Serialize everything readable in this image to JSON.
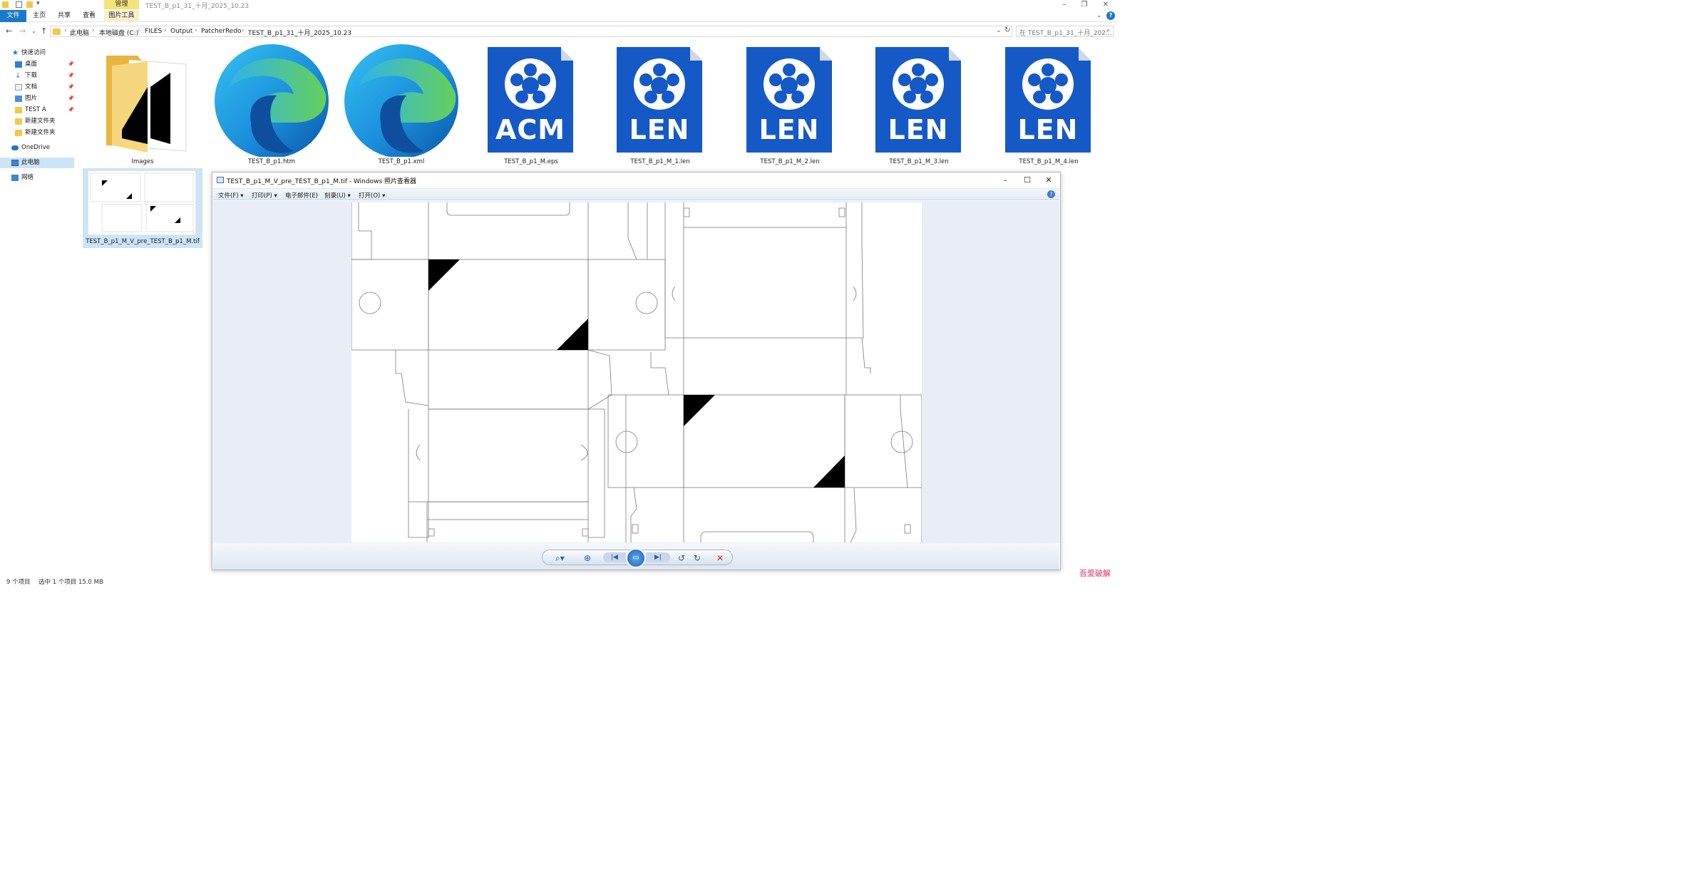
{
  "explorer": {
    "window_title": "TEST_B_p1_31_十月_2025_10.23",
    "manage_tab": "管理",
    "ribbon_tabs": [
      "文件",
      "主页",
      "共享",
      "查看",
      "图片工具"
    ],
    "breadcrumb": [
      "此电脑",
      "本地磁盘 (C:)",
      "FILES",
      "Output",
      "PatcherRedo",
      "TEST_B_p1_31_十月_2025_10.23"
    ],
    "search_placeholder": "在 TEST_B_p1_31_十月_202...",
    "nav": [
      {
        "label": "快速访问",
        "icon": "star-icon"
      },
      {
        "label": "桌面",
        "icon": "desktop-icon",
        "pinned": true
      },
      {
        "label": "下载",
        "icon": "download-icon",
        "pinned": true
      },
      {
        "label": "文档",
        "icon": "document-icon",
        "pinned": true
      },
      {
        "label": "图片",
        "icon": "pictures-icon",
        "pinned": true
      },
      {
        "label": "TEST A",
        "icon": "folder-icon",
        "pinned": true
      },
      {
        "label": "新建文件夹",
        "icon": "folder-icon"
      },
      {
        "label": "新建文件夹",
        "icon": "folder-icon"
      },
      {
        "label": "OneDrive",
        "icon": "cloud-icon"
      },
      {
        "label": "此电脑",
        "icon": "computer-icon",
        "selected": true
      },
      {
        "label": "网络",
        "icon": "network-icon"
      }
    ],
    "files": [
      {
        "name": "Images",
        "type": "folder"
      },
      {
        "name": "TEST_B_p1.htm",
        "type": "edge"
      },
      {
        "name": "TEST_B_p1.xml",
        "type": "edge"
      },
      {
        "name": "TEST_B_p1_M.eps",
        "type": "doc",
        "label": "ACM"
      },
      {
        "name": "TEST_B_p1_M_1.len",
        "type": "doc",
        "label": "LEN"
      },
      {
        "name": "TEST_B_p1_M_2.len",
        "type": "doc",
        "label": "LEN"
      },
      {
        "name": "TEST_B_p1_M_3.len",
        "type": "doc",
        "label": "LEN"
      },
      {
        "name": "TEST_B_p1_M_4.len",
        "type": "doc",
        "label": "LEN"
      },
      {
        "name": "TEST_B_p1_M_V_pre_TEST_B_p1_M.tif",
        "type": "tif",
        "selected": true
      }
    ],
    "status": {
      "count": "9 个项目",
      "selection": "选中 1 个项目  15.0 MB"
    }
  },
  "viewer": {
    "title": "TEST_B_p1_M_V_pre_TEST_B_p1_M.tif - Windows 照片查看器",
    "menus": [
      "文件(F)",
      "打印(P)",
      "电子邮件(E)",
      "刻录(U)",
      "打开(O)"
    ],
    "toolbar": [
      "zoom-icon",
      "fit-icon",
      "previous-icon",
      "slideshow-icon",
      "next-icon",
      "rotate-left-icon",
      "rotate-right-icon",
      "delete-icon"
    ]
  },
  "colors": {
    "accent": "#1979ca",
    "doc_blue": "#1559c6",
    "selection": "#cce4f7",
    "delete": "#d02020"
  },
  "watermark": "吾爱破解"
}
